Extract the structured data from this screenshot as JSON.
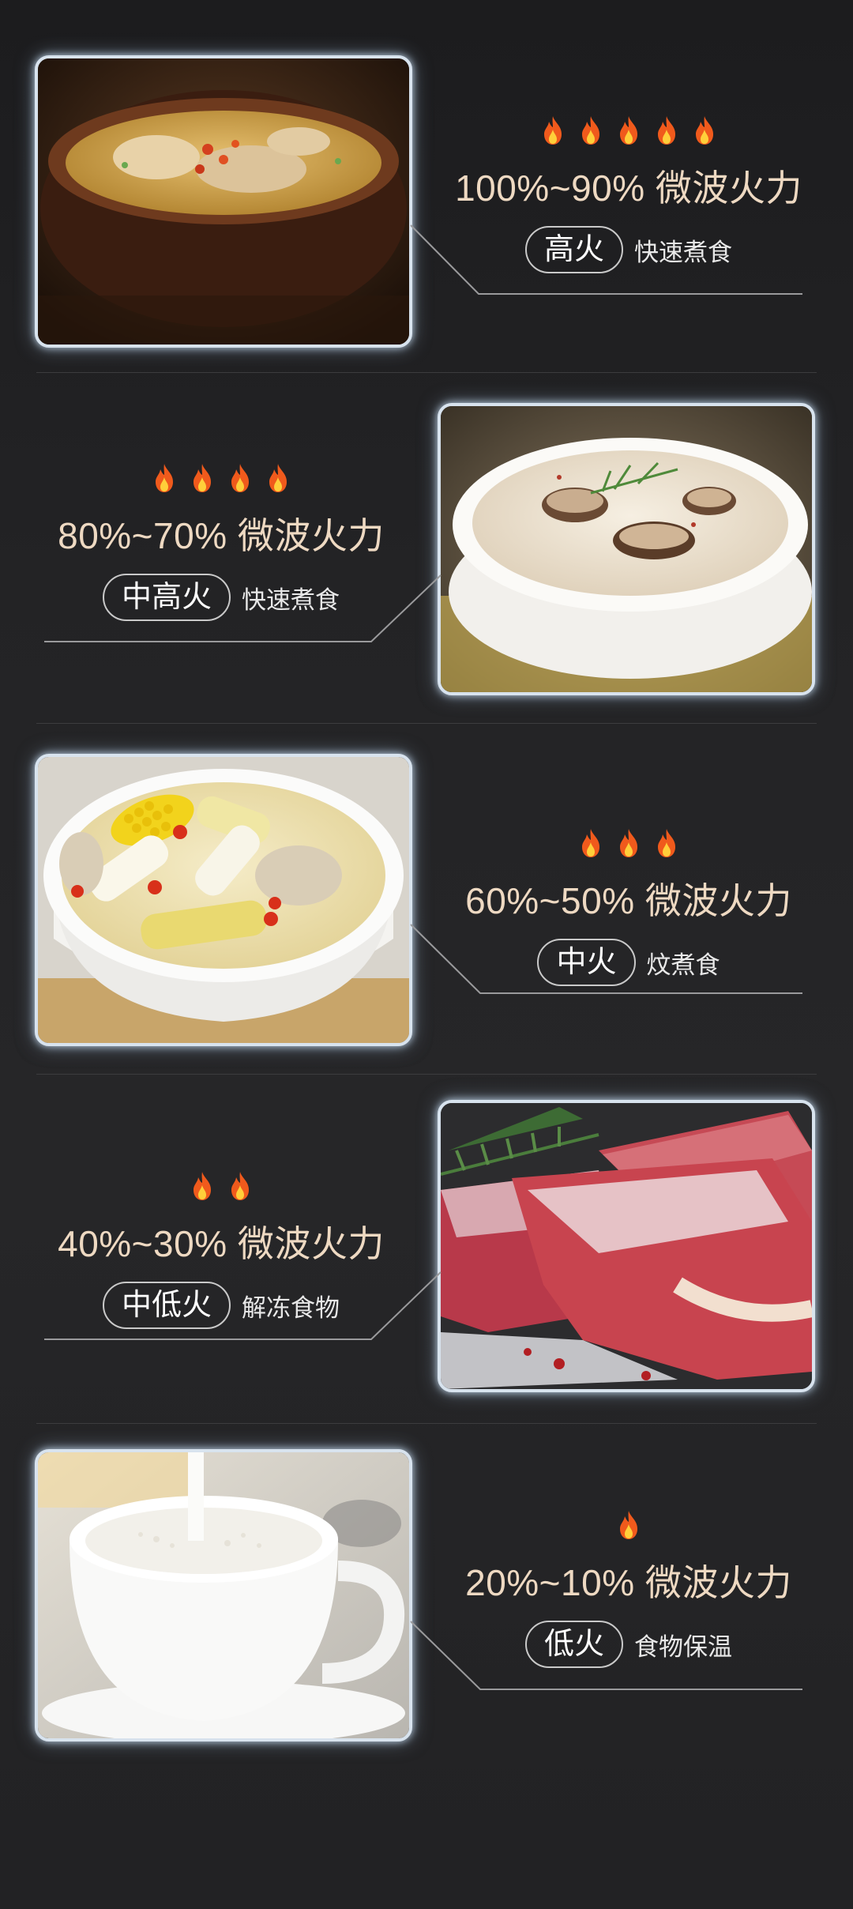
{
  "colors": {
    "background": "#1f1f21",
    "power_text": "#eed9c2",
    "pill_text": "#ffffff",
    "flame_outer": "#f05a1c",
    "flame_inner": "#ffcf3a"
  },
  "levels": [
    {
      "flame_count": 5,
      "power": "100%~90% 微波火力",
      "label": "高火",
      "desc": "快速煮食",
      "image": "clay-pot-chicken-soup"
    },
    {
      "flame_count": 4,
      "power": "80%~70% 微波火力",
      "label": "中高火",
      "desc": "快速煮食",
      "image": "mushroom-cream-soup"
    },
    {
      "flame_count": 3,
      "power": "60%~50% 微波火力",
      "label": "中火",
      "desc": "炆煮食",
      "image": "corn-yam-soup"
    },
    {
      "flame_count": 2,
      "power": "40%~30% 微波火力",
      "label": "中低火",
      "desc": "解冻食物",
      "image": "frozen-beef-steak"
    },
    {
      "flame_count": 1,
      "power": "20%~10% 微波火力",
      "label": "低火",
      "desc": "食物保温",
      "image": "milk-cup"
    }
  ]
}
